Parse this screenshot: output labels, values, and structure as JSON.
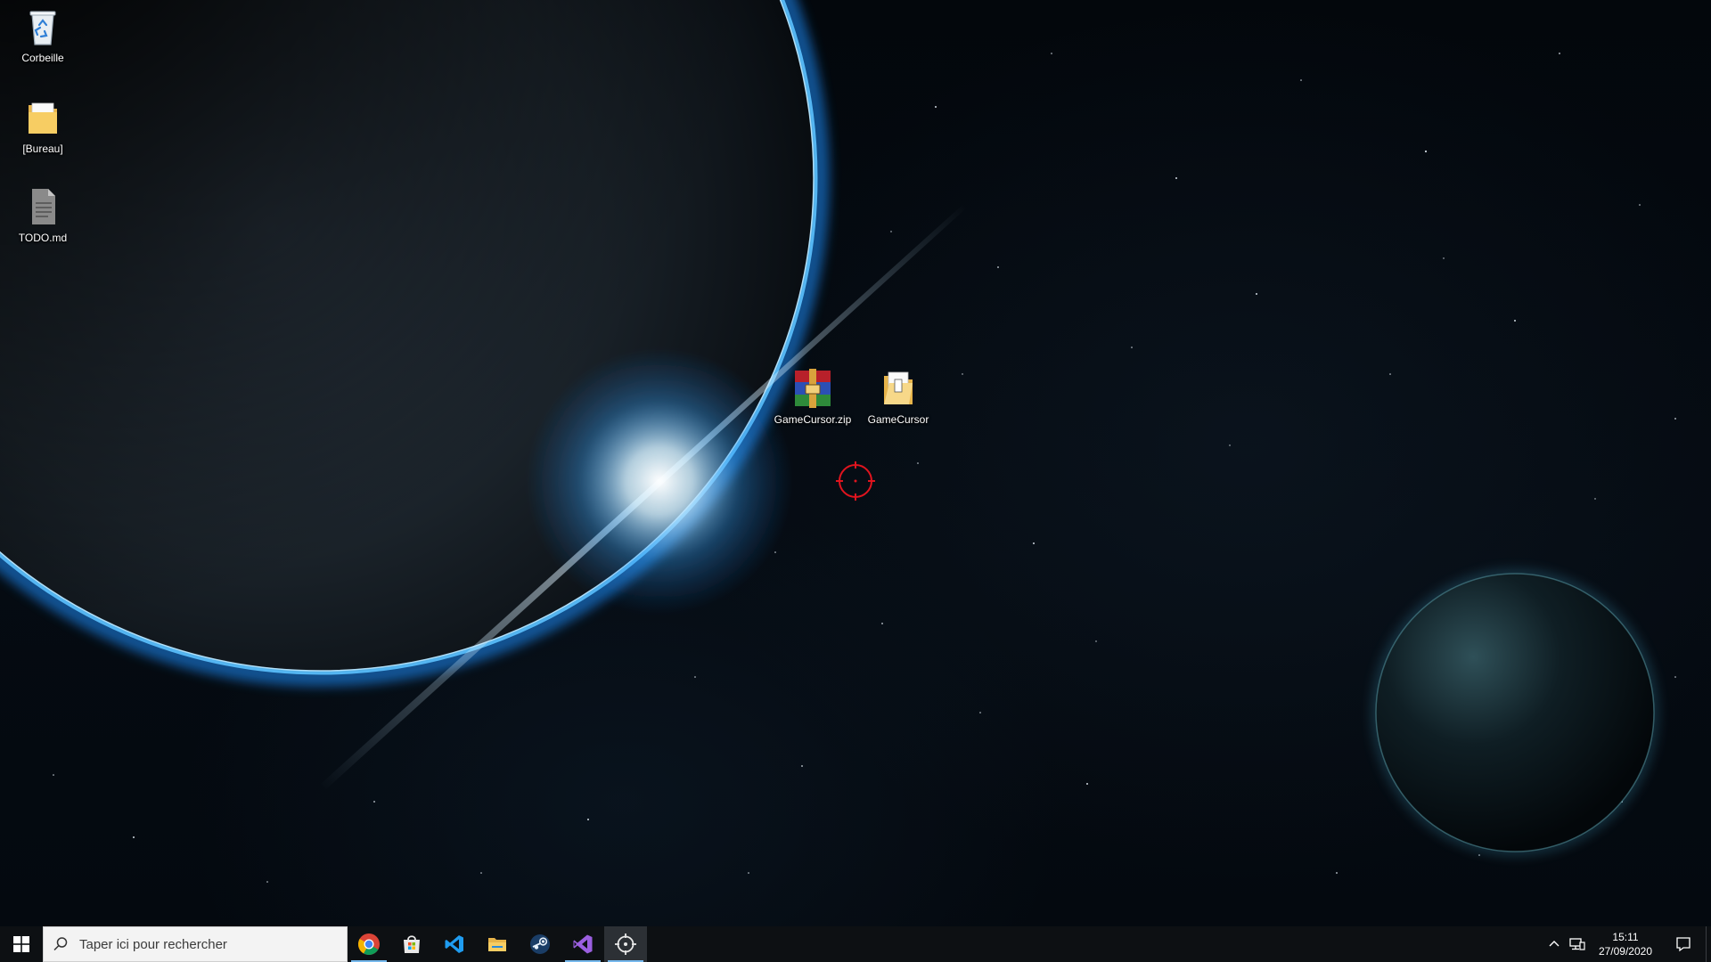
{
  "desktop": {
    "icons": [
      {
        "name": "recycle-bin",
        "label": "Corbeille",
        "icon": "recycle-bin-icon"
      },
      {
        "name": "folder-bureau",
        "label": "[Bureau]",
        "icon": "folder-icon"
      },
      {
        "name": "file-todo",
        "label": "TODO.md",
        "icon": "text-file-icon"
      },
      {
        "name": "archive-gamecursor",
        "label": "GameCursor.zip",
        "icon": "winrar-archive-icon"
      },
      {
        "name": "folder-gamecursor",
        "label": "GameCursor",
        "icon": "folder-icon"
      }
    ],
    "cursor": {
      "icon": "crosshair-cursor-icon",
      "color": "#e0141e"
    }
  },
  "taskbar": {
    "search_placeholder": "Taper ici pour rechercher",
    "apps": [
      {
        "name": "chrome",
        "icon": "chrome-icon",
        "running": true
      },
      {
        "name": "store",
        "icon": "store-icon",
        "running": false
      },
      {
        "name": "vscode",
        "icon": "vscode-icon",
        "running": false
      },
      {
        "name": "file-explorer",
        "icon": "folder-icon",
        "running": false
      },
      {
        "name": "steam",
        "icon": "steam-icon",
        "running": false
      },
      {
        "name": "visual-studio",
        "icon": "visual-studio-icon",
        "running": true
      },
      {
        "name": "gamecursor",
        "icon": "crosshair-icon",
        "running": true,
        "active": true
      }
    ],
    "clock": {
      "time": "15:11",
      "date": "27/09/2020"
    },
    "accent_color": "#76b9ed"
  }
}
